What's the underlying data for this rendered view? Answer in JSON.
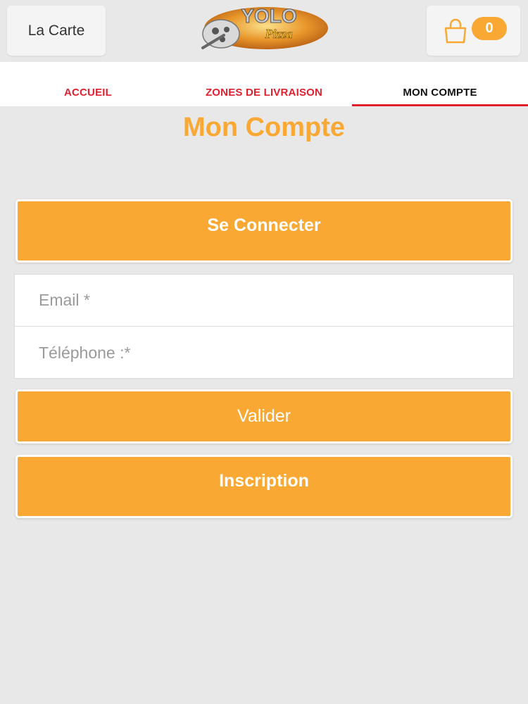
{
  "header": {
    "menu_label": "La Carte",
    "cart_count": "0",
    "logo_text_main": "YOLO",
    "logo_text_sub": "Pizza"
  },
  "tabs": [
    {
      "label": "ACCUEIL",
      "active": false
    },
    {
      "label": "ZONES DE LIVRAISON",
      "active": false
    },
    {
      "label": "MON COMPTE",
      "active": true
    }
  ],
  "page": {
    "title": "Mon Compte"
  },
  "login": {
    "connect_label": "Se Connecter",
    "email_placeholder": "Email *",
    "phone_placeholder": "Téléphone :*",
    "email_value": "",
    "phone_value": "",
    "submit_label": "Valider",
    "register_label": "Inscription"
  },
  "colors": {
    "accent": "#f9a833",
    "tab_red": "#e0202e",
    "background": "#e8e8e8"
  },
  "icons": {
    "cart": "shopping-bag-icon",
    "logo": "yolo-pizza-logo"
  }
}
